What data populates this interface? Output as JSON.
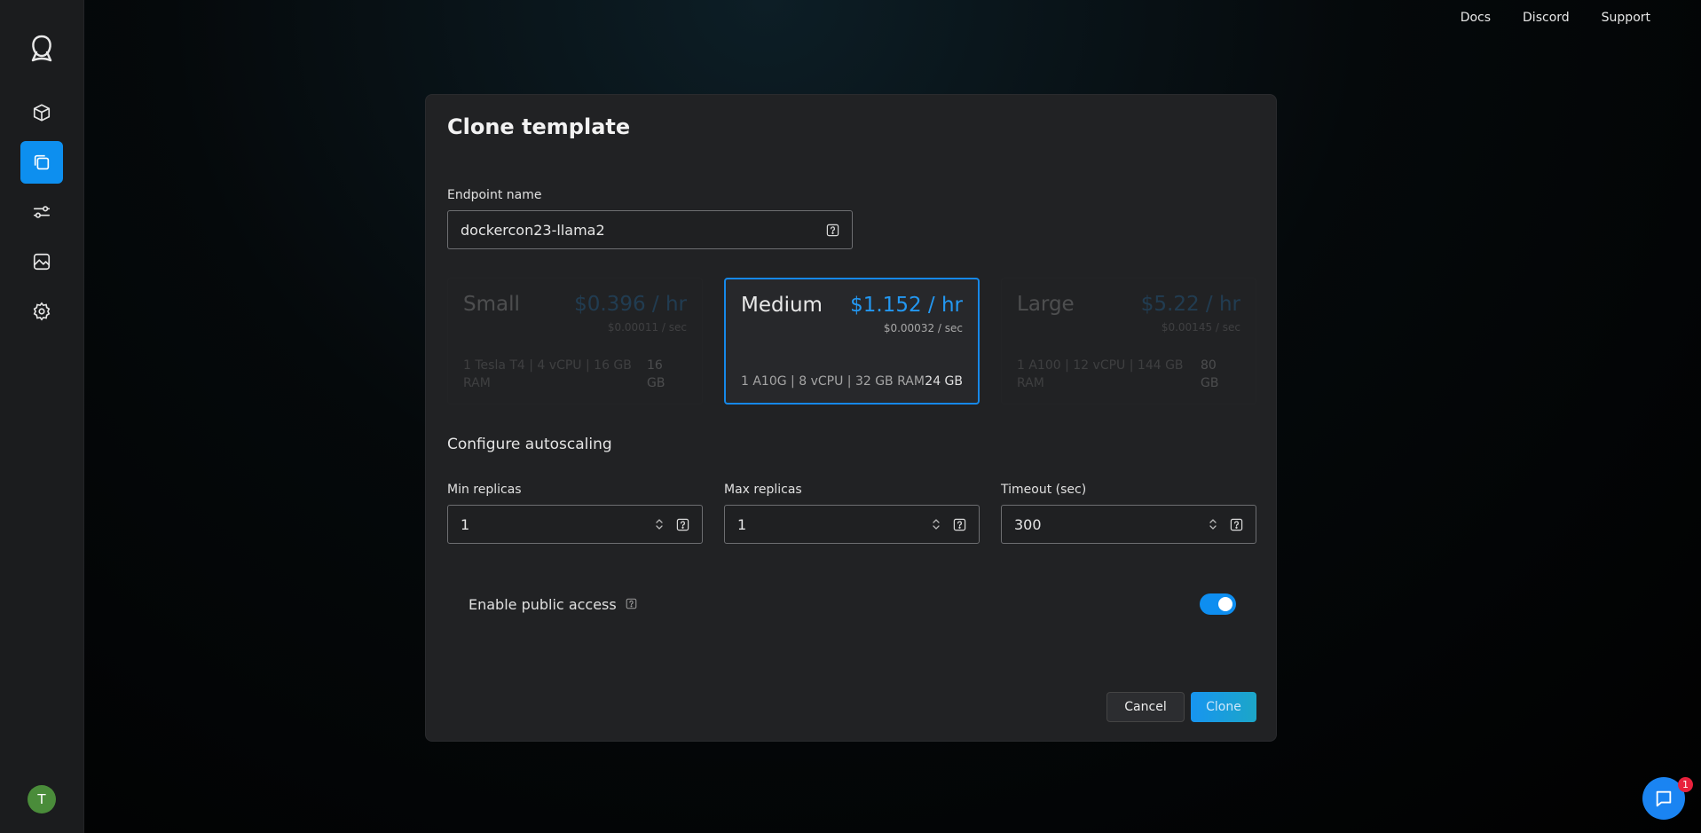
{
  "topnav": {
    "links": [
      "Docs",
      "Discord",
      "Support"
    ]
  },
  "sidebar": {
    "items": [
      {
        "icon": "cube-icon"
      },
      {
        "icon": "templates-icon",
        "active": true
      },
      {
        "icon": "sliders-icon"
      },
      {
        "icon": "image-icon"
      },
      {
        "icon": "gear-icon"
      }
    ],
    "avatar_initial": "T"
  },
  "modal": {
    "title": "Clone template",
    "endpoint": {
      "label": "Endpoint name",
      "value": "dockercon23-llama2"
    },
    "tiers": [
      {
        "name": "Small",
        "price": "$0.396 / hr",
        "per_sec": "$0.00011 / sec",
        "specs": "1 Tesla T4 | 4 vCPU | 16 GB RAM",
        "vram": "16 GB",
        "state": "disabled"
      },
      {
        "name": "Medium",
        "price": "$1.152 / hr",
        "per_sec": "$0.00032 / sec",
        "specs": "1 A10G | 8 vCPU | 32 GB RAM",
        "vram": "24 GB",
        "state": "selected"
      },
      {
        "name": "Large",
        "price": "$5.22 / hr",
        "per_sec": "$0.00145 / sec",
        "specs": "1 A100 | 12 vCPU | 144 GB RAM",
        "vram": "80 GB",
        "state": "disabled"
      }
    ],
    "autoscaling": {
      "title": "Configure autoscaling",
      "min_replicas": {
        "label": "Min replicas",
        "value": "1"
      },
      "max_replicas": {
        "label": "Max replicas",
        "value": "1"
      },
      "timeout": {
        "label": "Timeout (sec)",
        "value": "300"
      }
    },
    "public_access": {
      "label": "Enable public access",
      "enabled": true
    },
    "cancel_label": "Cancel",
    "clone_label": "Clone"
  },
  "chat": {
    "badge_count": "1"
  },
  "colors": {
    "accent": "#0d8fef",
    "modal_bg": "#212224",
    "sidebar_bg": "#1b1c1e"
  }
}
